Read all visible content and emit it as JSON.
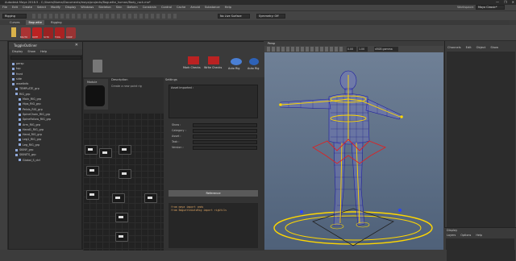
{
  "titlebar": {
    "title": "Autodesk Maya 2018.5 - C:/Users/Numa/Documents/maya/projects/Baguette_human/Body_rock.ma*",
    "minimize": "—",
    "maximize": "❐",
    "close": "✕"
  },
  "menubar": [
    "File",
    "Edit",
    "Create",
    "Select",
    "Modify",
    "Display",
    "Windows",
    "Skeleton",
    "Skin",
    "Deform",
    "Constrain",
    "Control",
    "Cache",
    "Arnold",
    "Substance",
    "Help"
  ],
  "workspace": {
    "label": "Workspace:",
    "value": "Maya Classic*"
  },
  "statusline": {
    "mode": "Rigging",
    "surface": "No Live Surface",
    "symmetry": "Symmetry: Off"
  },
  "shelf": {
    "tabs": [
      "Curves",
      "Baguette",
      "Rigging"
    ],
    "active_tab": "Baguette",
    "buttons": [
      "BAUTO",
      "ROTE",
      "SCTR",
      "TOOL",
      "COOP"
    ]
  },
  "outliner": {
    "title": "ToggleOutliner",
    "menu": [
      "Display",
      "Show",
      "Help"
    ],
    "items": [
      "persp",
      "top",
      "front",
      "side",
      "assetinfo",
      "TEMPLATE_grp",
      "RIG_grp",
      "Main_RIG_grp",
      "Hips_RIG_grp",
      "Pelvis_RIG_grp",
      "SpineChain_RIG_grp",
      "SpineFollow_RIG_grp",
      "Arm_RIG_grp",
      "Hand1_RIG_grp",
      "Hand_RIG_grp",
      "Leg1_RIG_grp",
      "Leg_RIG_grp",
      "SKINY_grp",
      "SKINITS_grp",
      "Global_S_ctrl"
    ]
  },
  "modulepanel": {
    "buttons": [
      "Mark Checks",
      "Write Checks",
      "Auto Rig",
      "Auto Rig"
    ],
    "module_label": "Module",
    "description_title": "Description",
    "description_text": "Create a new point rig",
    "settings_title": "Settings",
    "asset_label": "Asset imported :",
    "fields": [
      "Show :",
      "Category :",
      "Asset :",
      "Task :",
      "Version :"
    ],
    "reference_btn": "Reference",
    "code": [
      "from maya import cmds",
      "from BaguetteAutoRig import rigUtils"
    ]
  },
  "viewport": {
    "panel_label": "Persp",
    "color_space": "sRGB gamma",
    "gamma_value": "1.00",
    "zero_value": "0.00"
  },
  "rightpanel": {
    "tabs": [
      "Channels",
      "Edit",
      "Object",
      "Show"
    ]
  },
  "layers": {
    "title": "Display",
    "tabs": [
      "Layers",
      "Options",
      "Help"
    ]
  },
  "colors": {
    "accent": "#ffd700",
    "mesh": "#2222aa",
    "viewport_bg": "#5b6f87"
  }
}
